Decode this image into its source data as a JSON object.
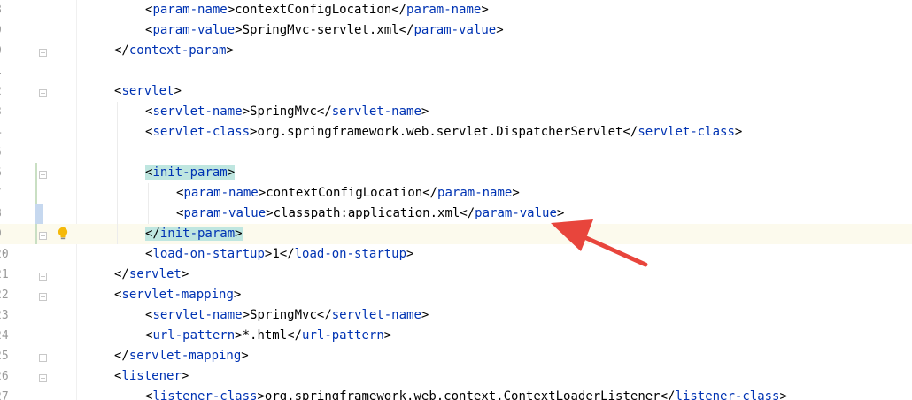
{
  "editor": {
    "lines": [
      {
        "no": "8",
        "indent": 2,
        "tokens": [
          [
            "b",
            "<"
          ],
          [
            "t",
            "param-name"
          ],
          [
            "b",
            ">"
          ],
          [
            "txt",
            "contextConfigLocation"
          ],
          [
            "b",
            "</"
          ],
          [
            "t",
            "param-name"
          ],
          [
            "b",
            ">"
          ]
        ]
      },
      {
        "no": "9",
        "indent": 2,
        "tokens": [
          [
            "b",
            "<"
          ],
          [
            "t",
            "param-value"
          ],
          [
            "b",
            ">"
          ],
          [
            "txt",
            "SpringMvc-servlet.xml"
          ],
          [
            "b",
            "</"
          ],
          [
            "t",
            "param-value"
          ],
          [
            "b",
            ">"
          ]
        ]
      },
      {
        "no": "0",
        "indent": 1,
        "fold": "end",
        "tokens": [
          [
            "b",
            "</"
          ],
          [
            "t",
            "context-param"
          ],
          [
            "b",
            ">"
          ]
        ]
      },
      {
        "no": "1",
        "indent": 0,
        "tokens": []
      },
      {
        "no": "2",
        "indent": 1,
        "fold": "start",
        "tokens": [
          [
            "b",
            "<"
          ],
          [
            "t",
            "servlet"
          ],
          [
            "b",
            ">"
          ]
        ]
      },
      {
        "no": "3",
        "indent": 2,
        "tokens": [
          [
            "b",
            "<"
          ],
          [
            "t",
            "servlet-name"
          ],
          [
            "b",
            ">"
          ],
          [
            "txt",
            "SpringMvc"
          ],
          [
            "b",
            "</"
          ],
          [
            "t",
            "servlet-name"
          ],
          [
            "b",
            ">"
          ]
        ]
      },
      {
        "no": "4",
        "indent": 2,
        "tokens": [
          [
            "b",
            "<"
          ],
          [
            "t",
            "servlet-class"
          ],
          [
            "b",
            ">"
          ],
          [
            "txt",
            "org.springframework.web.servlet.DispatcherServlet"
          ],
          [
            "b",
            "</"
          ],
          [
            "t",
            "servlet-class"
          ],
          [
            "b",
            ">"
          ]
        ]
      },
      {
        "no": "5",
        "indent": 0,
        "tokens": []
      },
      {
        "no": "6",
        "indent": 2,
        "fold": "start",
        "change": "add",
        "tokens": [
          [
            "hl",
            "<"
          ],
          [
            "hlt",
            "init-param"
          ],
          [
            "hl",
            ">"
          ]
        ]
      },
      {
        "no": "7",
        "indent": 3,
        "change": "add",
        "tokens": [
          [
            "b",
            "<"
          ],
          [
            "t",
            "param-name"
          ],
          [
            "b",
            ">"
          ],
          [
            "txt",
            "contextConfigLocation"
          ],
          [
            "b",
            "</"
          ],
          [
            "t",
            "param-name"
          ],
          [
            "b",
            ">"
          ]
        ]
      },
      {
        "no": "8",
        "indent": 3,
        "change": "mod",
        "tokens": [
          [
            "b",
            "<"
          ],
          [
            "t",
            "param-value"
          ],
          [
            "b",
            ">"
          ],
          [
            "txt",
            "classpath:application.xml"
          ],
          [
            "b",
            "</"
          ],
          [
            "t",
            "param-value"
          ],
          [
            "b",
            ">"
          ]
        ]
      },
      {
        "no": "9",
        "indent": 2,
        "fold": "end",
        "change": "add",
        "current": true,
        "bulb": true,
        "caret": true,
        "tokens": [
          [
            "hl",
            "</"
          ],
          [
            "hlt",
            "init-param"
          ],
          [
            "hl",
            ">"
          ]
        ]
      },
      {
        "no": "20",
        "indent": 2,
        "tokens": [
          [
            "b",
            "<"
          ],
          [
            "t",
            "load-on-startup"
          ],
          [
            "b",
            ">"
          ],
          [
            "txt",
            "1"
          ],
          [
            "b",
            "</"
          ],
          [
            "t",
            "load-on-startup"
          ],
          [
            "b",
            ">"
          ]
        ]
      },
      {
        "no": "21",
        "indent": 1,
        "fold": "end",
        "tokens": [
          [
            "b",
            "</"
          ],
          [
            "t",
            "servlet"
          ],
          [
            "b",
            ">"
          ]
        ]
      },
      {
        "no": "22",
        "indent": 1,
        "fold": "start",
        "tokens": [
          [
            "b",
            "<"
          ],
          [
            "t",
            "servlet-mapping"
          ],
          [
            "b",
            ">"
          ]
        ]
      },
      {
        "no": "23",
        "indent": 2,
        "tokens": [
          [
            "b",
            "<"
          ],
          [
            "t",
            "servlet-name"
          ],
          [
            "b",
            ">"
          ],
          [
            "txt",
            "SpringMvc"
          ],
          [
            "b",
            "</"
          ],
          [
            "t",
            "servlet-name"
          ],
          [
            "b",
            ">"
          ]
        ]
      },
      {
        "no": "24",
        "indent": 2,
        "tokens": [
          [
            "b",
            "<"
          ],
          [
            "t",
            "url-pattern"
          ],
          [
            "b",
            ">"
          ],
          [
            "txt",
            "*.html"
          ],
          [
            "b",
            "</"
          ],
          [
            "t",
            "url-pattern"
          ],
          [
            "b",
            ">"
          ]
        ]
      },
      {
        "no": "25",
        "indent": 1,
        "fold": "end",
        "tokens": [
          [
            "b",
            "</"
          ],
          [
            "t",
            "servlet-mapping"
          ],
          [
            "b",
            ">"
          ]
        ]
      },
      {
        "no": "26",
        "indent": 1,
        "fold": "start",
        "tokens": [
          [
            "b",
            "<"
          ],
          [
            "t",
            "listener"
          ],
          [
            "b",
            ">"
          ]
        ]
      },
      {
        "no": "27",
        "indent": 2,
        "tokens": [
          [
            "b",
            "<"
          ],
          [
            "t",
            "listener-class"
          ],
          [
            "b",
            ">"
          ],
          [
            "txt",
            "org.springframework.web.context.ContextLoaderListener"
          ],
          [
            "b",
            "</"
          ],
          [
            "t",
            "listener-class"
          ],
          [
            "b",
            ">"
          ]
        ]
      }
    ]
  },
  "colors": {
    "tag": "#0033b3",
    "text": "#000000",
    "current_line": "#fcfaed",
    "match_highlight": "#bfe6e0",
    "arrow": "#e8453c",
    "bulb": "#f5b90a"
  },
  "icons": {
    "bulb": "lightbulb-icon",
    "fold": "fold-marker-icon"
  }
}
